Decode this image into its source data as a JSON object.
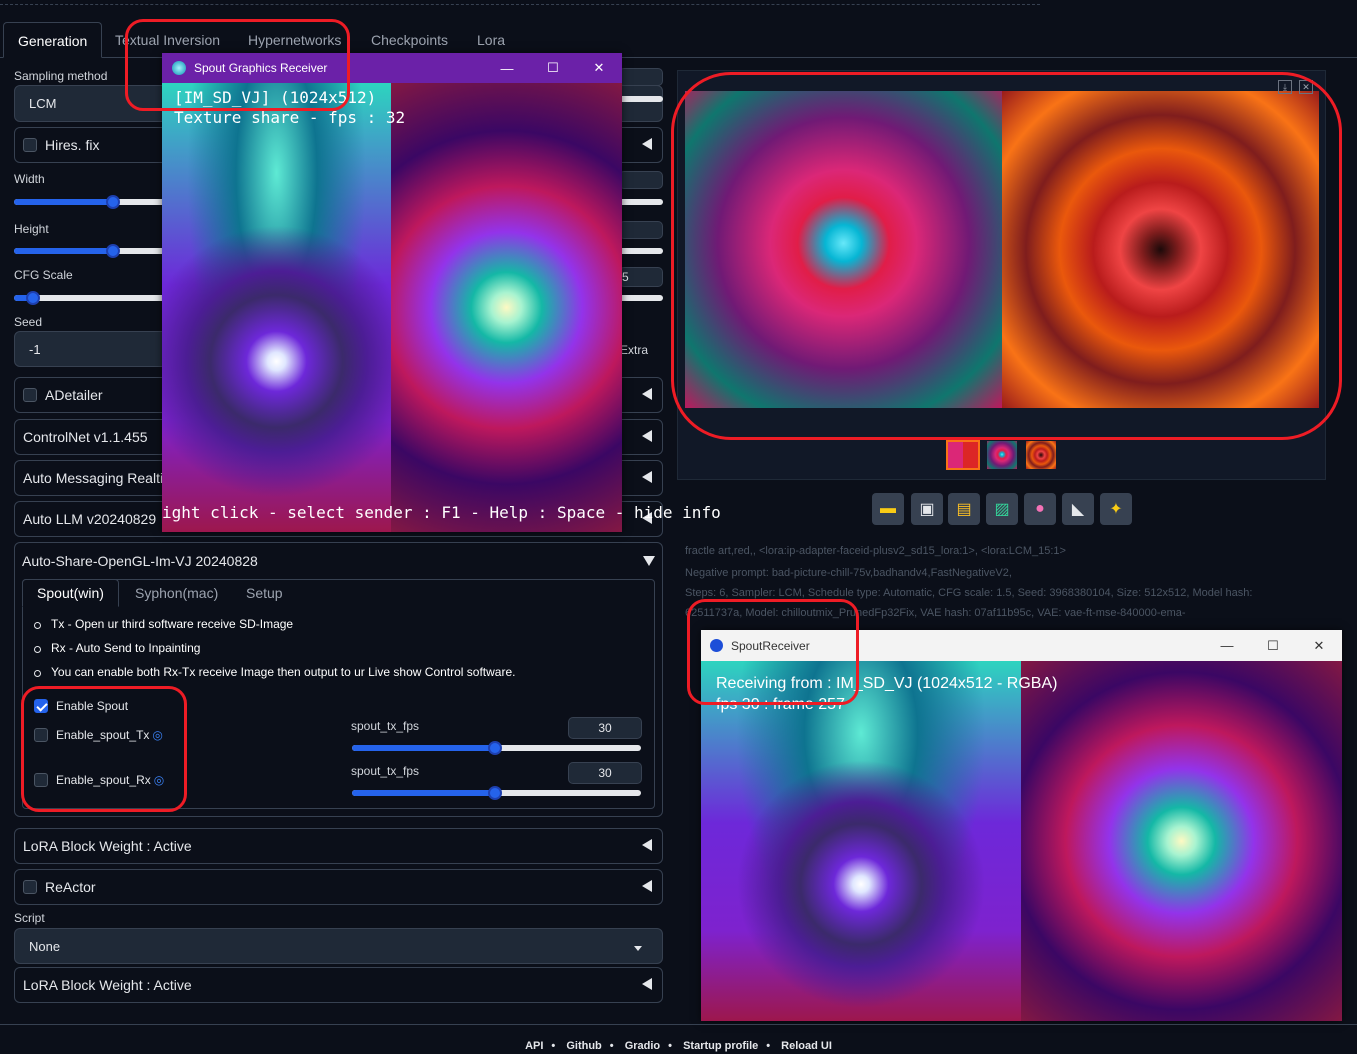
{
  "tabs": [
    "Generation",
    "Textual Inversion",
    "Hypernetworks",
    "Checkpoints",
    "Lora"
  ],
  "left": {
    "sampling_label": "Sampling method",
    "sampling_value": "LCM",
    "hires_label": "Hires. fix",
    "width_label": "Width",
    "height_label": "Height",
    "cfg_label": "CFG Scale",
    "seed_label": "Seed",
    "seed_value": "-1",
    "extra_label": "Extra",
    "cfg_partial": "5",
    "accordions": {
      "adetailer": "ADetailer",
      "controlnet": "ControlNet v1.1.455",
      "auto_messaging": "Auto Messaging Realtim",
      "auto_llm": "Auto LLM v20240829",
      "auto_share": "Auto-Share-OpenGL-Im-VJ 20240828",
      "lora_block_1": "LoRA Block Weight : Active",
      "reactor": "ReActor",
      "lora_block_2": "LoRA Block Weight : Active"
    },
    "script_label": "Script",
    "script_value": "None"
  },
  "spout_panel": {
    "subtabs": [
      "Spout(win)",
      "Syphon(mac)",
      "Setup"
    ],
    "bullets": [
      "Tx - Open ur third software receive SD-Image",
      "Rx - Auto Send to Inpainting",
      "You can enable both Rx-Tx receive Image then output to ur Live show Control software."
    ],
    "enable_spout": "Enable Spout",
    "enable_tx": "Enable_spout_Tx",
    "enable_rx": "Enable_spout_Rx",
    "tx_fps_label": "spout_tx_fps",
    "tx_fps_value": "30",
    "rx_fps_label": "spout_tx_fps",
    "rx_fps_value": "30"
  },
  "spout_window": {
    "title": "Spout Graphics Receiver",
    "line1": "[IM_SD_VJ]  (1024x512)",
    "line2": "Texture share - fps : 32",
    "bottom": "ight click - select sender : F1 - Help : Space - hide info"
  },
  "gallery_info": [
    "fractle art,red,, <lora:ip-adapter-faceid-plusv2_sd15_lora:1>, <lora:LCM_15:1>",
    "Negative prompt: bad-picture-chill-75v,badhandv4,FastNegativeV2,",
    "Steps: 6, Sampler: LCM, Schedule type: Automatic, CFG scale: 1.5, Seed: 3968380104, Size: 512x512, Model hash:",
    "62511737a, Model: chilloutmix_PrunedFp32Fix, VAE hash: 07af11b95c, VAE: vae-ft-mse-840000-ema-"
  ],
  "receiver_window": {
    "title": "SpoutReceiver",
    "line1": "Receiving from : IM_SD_VJ  (1024x512 - RGBA)",
    "line2": "fps 30 : frame 257"
  },
  "footer": [
    "API",
    "Github",
    "Gradio",
    "Startup profile",
    "Reload UI"
  ],
  "icons": [
    "folder-icon",
    "save-icon",
    "zip-icon",
    "image-icon",
    "palette-icon",
    "ruler-icon",
    "sparkle-icon"
  ],
  "colors": {
    "accent": "#2563eb",
    "annotation": "#ee1c25",
    "spout_title": "#6b21a8"
  }
}
